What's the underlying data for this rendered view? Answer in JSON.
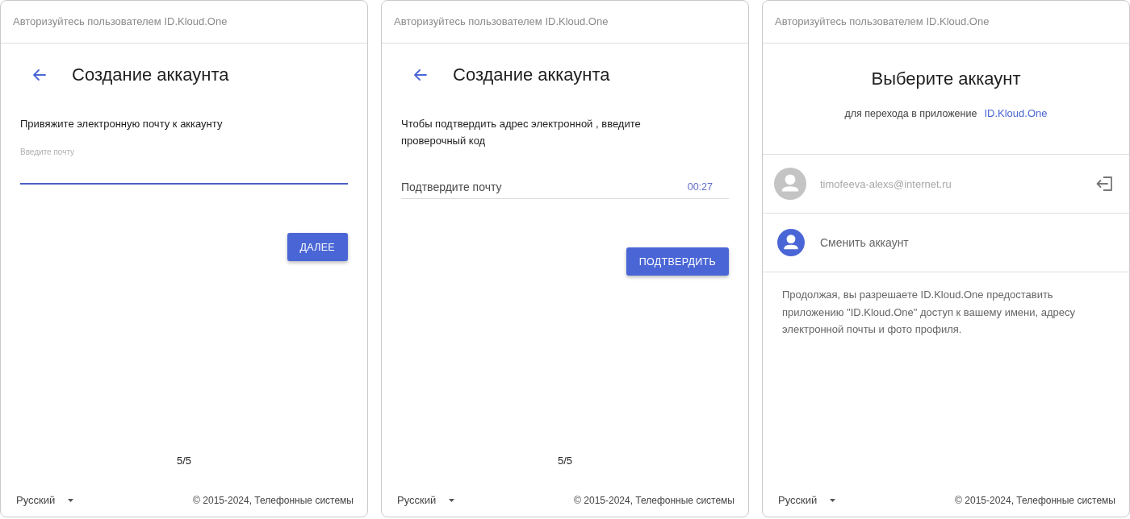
{
  "panels": [
    {
      "kind": "email_entry",
      "header": "Авторизуйтесь пользователем ID.Kloud.One",
      "title": "Создание аккаунта",
      "prompt": "Привяжите электронную почту к аккаунту",
      "field": {
        "label": "Введите почту",
        "focused": true
      },
      "button": "ДАЛЕЕ",
      "step": "5/5",
      "footer": {
        "language": "Русский",
        "copyright": "© 2015-2024, Телефонные системы"
      }
    },
    {
      "kind": "code_entry",
      "header": "Авторизуйтесь пользователем ID.Kloud.One",
      "title": "Создание аккаунта",
      "prompt": "Чтобы подтвердить адрес электронной , введите проверочный код",
      "field": {
        "placeholder": "Подтвердите почту",
        "timer": "00:27",
        "focused": false
      },
      "button": "ПОДТВЕРДИТЬ",
      "step": "5/5",
      "footer": {
        "language": "Русский",
        "copyright": "© 2015-2024, Телефонные системы"
      }
    },
    {
      "kind": "account_choice",
      "header": "Авторизуйтесь пользователем ID.Kloud.One",
      "title": "Выберите аккаунт",
      "subtitle": "для перехода в приложение",
      "app_link": "ID.Kloud.One",
      "accounts": [
        {
          "email": "timofeeva-alexs@internet.ru"
        }
      ],
      "switch_account": "Сменить аккаунт",
      "consent": "Продолжая, вы разрешаете ID.Kloud.One предоставить приложению \"ID.Kloud.One\" доступ к вашему имени, адресу электронной почты и фото профиля.",
      "footer": {
        "language": "Русский",
        "copyright": "© 2015-2024, Телефонные системы"
      }
    }
  ]
}
